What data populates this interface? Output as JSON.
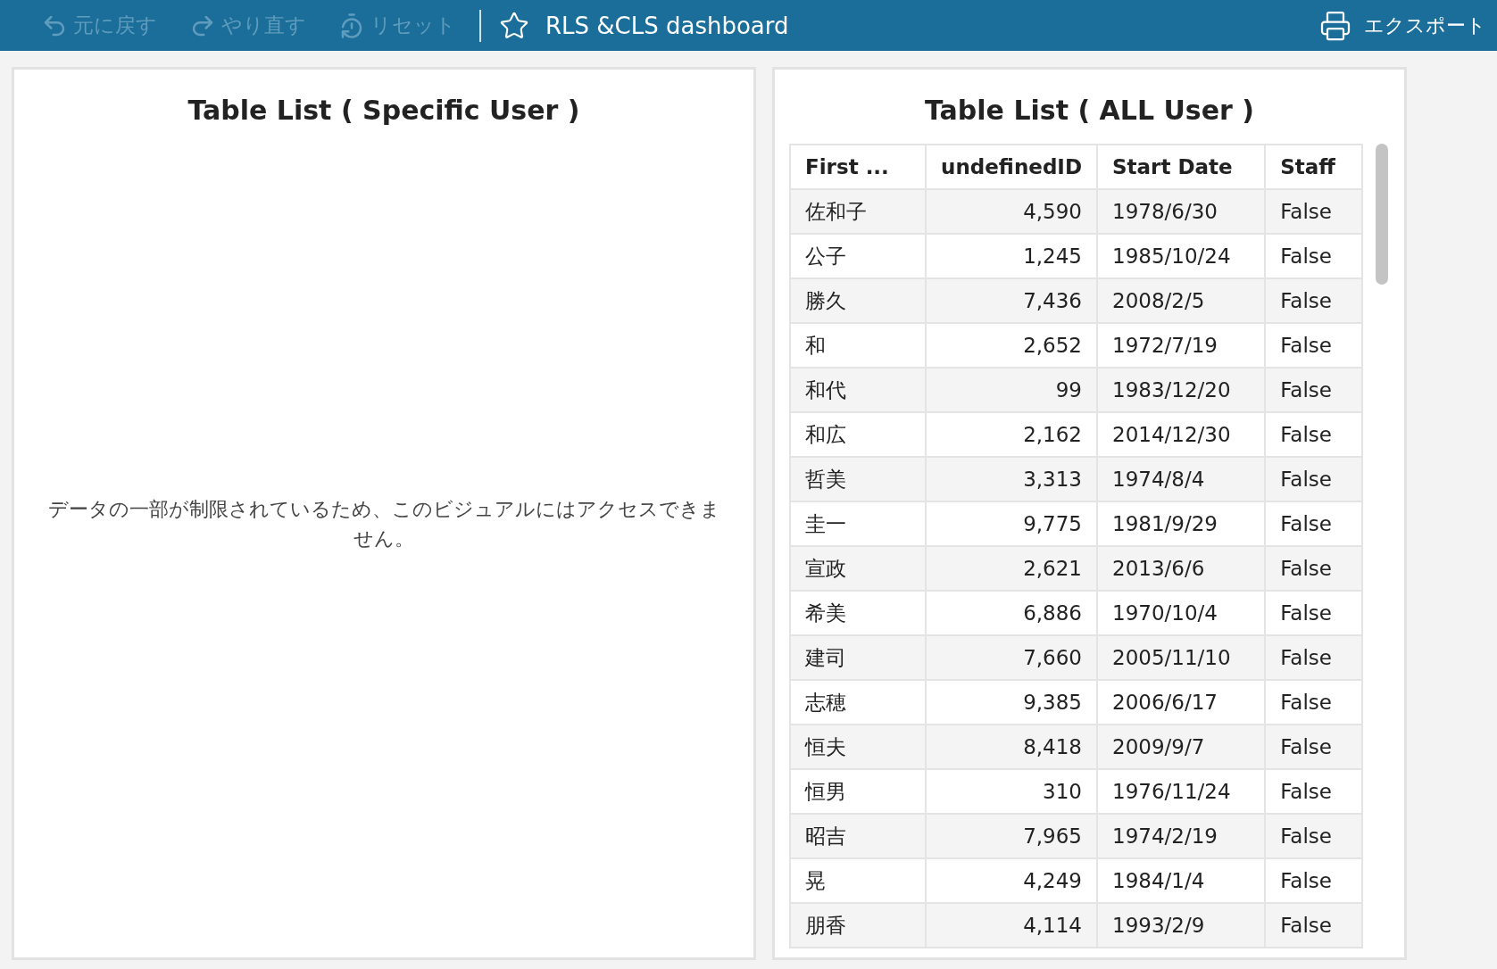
{
  "toolbar": {
    "actions": [
      {
        "kind": "undo",
        "label": "元に戻す",
        "disabled": true
      },
      {
        "kind": "redo",
        "label": "やり直す",
        "disabled": true
      },
      {
        "kind": "reset",
        "label": "リセット",
        "disabled": true
      }
    ],
    "title": "RLS &CLS dashboard",
    "favorite": false,
    "export": {
      "label": "エクスポート"
    }
  },
  "panels": [
    {
      "title": "Table List ( Specific User )",
      "message": "データの一部が制限されているため、このビジュアルにはアクセスできません。"
    },
    {
      "title": "Table List ( ALL User )",
      "table": {
        "columns": [
          {
            "label": "First ...",
            "kind": "text"
          },
          {
            "label": "undefinedID",
            "kind": "number"
          },
          {
            "label": "Start Date",
            "kind": "text"
          },
          {
            "label": "Staff",
            "kind": "text"
          }
        ],
        "rows": [
          [
            "佐和子",
            "4,590",
            "1978/6/30",
            "False"
          ],
          [
            "公子",
            "1,245",
            "1985/10/24",
            "False"
          ],
          [
            "勝久",
            "7,436",
            "2008/2/5",
            "False"
          ],
          [
            "和",
            "2,652",
            "1972/7/19",
            "False"
          ],
          [
            "和代",
            "99",
            "1983/12/20",
            "False"
          ],
          [
            "和広",
            "2,162",
            "2014/12/30",
            "False"
          ],
          [
            "哲美",
            "3,313",
            "1974/8/4",
            "False"
          ],
          [
            "圭一",
            "9,775",
            "1981/9/29",
            "False"
          ],
          [
            "宣政",
            "2,621",
            "2013/6/6",
            "False"
          ],
          [
            "希美",
            "6,886",
            "1970/10/4",
            "False"
          ],
          [
            "建司",
            "7,660",
            "2005/11/10",
            "False"
          ],
          [
            "志穂",
            "9,385",
            "2006/6/17",
            "False"
          ],
          [
            "恒夫",
            "8,418",
            "2009/9/7",
            "False"
          ],
          [
            "恒男",
            "310",
            "1976/11/24",
            "False"
          ],
          [
            "昭吉",
            "7,965",
            "1974/2/19",
            "False"
          ],
          [
            "晃",
            "4,249",
            "1984/1/4",
            "False"
          ],
          [
            "朋香",
            "4,114",
            "1993/2/9",
            "False"
          ]
        ]
      }
    }
  ]
}
